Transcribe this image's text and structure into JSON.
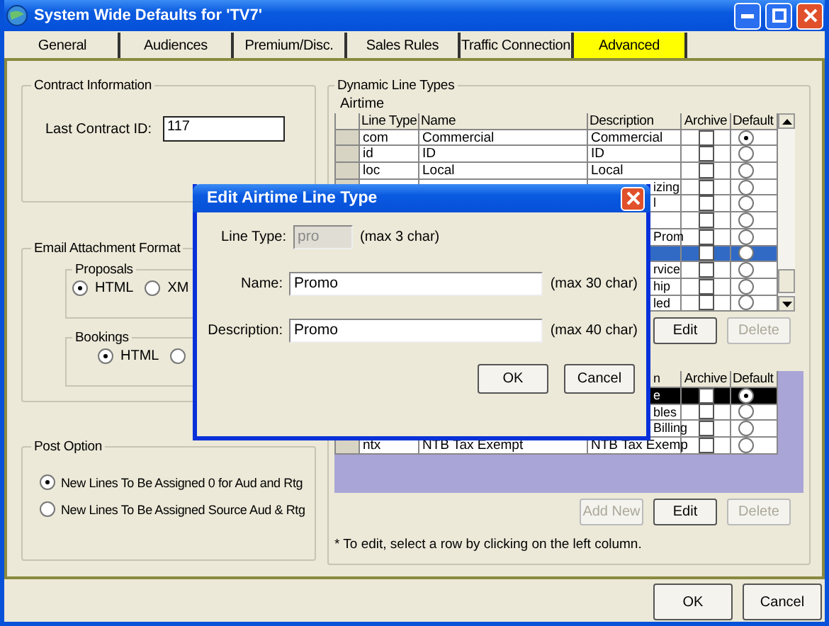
{
  "window": {
    "title": "System Wide Defaults for 'TV7'"
  },
  "tabs": [
    {
      "label": "General",
      "selected": false
    },
    {
      "label": "Audiences",
      "selected": false
    },
    {
      "label": "Premium/Disc.",
      "selected": false
    },
    {
      "label": "Sales Rules",
      "selected": false
    },
    {
      "label": "Traffic Connection",
      "selected": false
    },
    {
      "label": "Advanced",
      "selected": true
    }
  ],
  "contract_information": {
    "title": "Contract Information",
    "label": "Last Contract ID:",
    "value": "117"
  },
  "email_attachment_format": {
    "title": "Email Attachment Format",
    "groups": [
      {
        "title": "Proposals",
        "options": [
          {
            "label": "HTML",
            "selected": true
          },
          {
            "label": "XM",
            "selected": false
          }
        ]
      },
      {
        "title": "Bookings",
        "options": [
          {
            "label": "HTML",
            "selected": true
          },
          {
            "selected": false
          }
        ]
      }
    ]
  },
  "post_option": {
    "title": "Post Option",
    "options": [
      {
        "label": "New Lines To Be Assigned 0 for Aud and Rtg",
        "selected": true
      },
      {
        "label": "New Lines To Be Assigned Source Aud & Rtg",
        "selected": false
      }
    ]
  },
  "dynamic_line_types": {
    "title": "Dynamic Line Types",
    "airtime_label": "Airtime",
    "tables": [
      {
        "header": {
          "line_type": "Line Type",
          "name": "Name",
          "description": "Description",
          "archive": "Archive",
          "default": "Default"
        },
        "rows": [
          {
            "line_type": "com",
            "name": "Commercial",
            "description": "Commercial",
            "archive": false,
            "default": true,
            "selected": false
          },
          {
            "line_type": "id",
            "name": "ID",
            "description": "ID",
            "archive": false,
            "default": false,
            "selected": false
          },
          {
            "line_type": "loc",
            "name": "Local",
            "description": "Local",
            "archive": false,
            "default": false,
            "selected": false
          },
          {
            "description": "izing",
            "archive": false,
            "default": false,
            "selected": false
          },
          {
            "description": "l",
            "archive": false,
            "default": false,
            "selected": false
          },
          {
            "archive": false,
            "default": false,
            "selected": false
          },
          {
            "description": "Prom",
            "archive": false,
            "default": false,
            "selected": false
          },
          {
            "archive": false,
            "default": false,
            "selected": true
          },
          {
            "description": "rvice",
            "archive": false,
            "default": false,
            "selected": false
          },
          {
            "description": "hip",
            "archive": false,
            "default": false,
            "selected": false
          },
          {
            "description": "led",
            "archive": false,
            "default": false,
            "selected": false
          }
        ],
        "buttons": [
          {
            "label": "Edit",
            "disabled": false
          },
          {
            "label": "Delete",
            "disabled": true
          }
        ]
      },
      {
        "header": {
          "description": "n",
          "archive": "Archive",
          "default": "Default"
        },
        "rows": [
          {
            "description": "e",
            "archive": false,
            "default": true,
            "selected": true
          },
          {
            "description": "bles",
            "archive": false,
            "default": false,
            "selected": false
          },
          {
            "description": "Billing",
            "archive": false,
            "default": false,
            "selected": false
          },
          {
            "line_type": "ntx",
            "name": "NTB Tax Exempt",
            "description": "NTB Tax Exemp",
            "archive": false,
            "default": false,
            "selected": false
          }
        ],
        "buttons": [
          {
            "label": "Add New",
            "disabled": true
          },
          {
            "label": "Edit",
            "disabled": false
          },
          {
            "label": "Delete",
            "disabled": true
          }
        ]
      }
    ],
    "note": "* To edit, select a row by clicking on the left column."
  },
  "footer_buttons": [
    {
      "label": "OK"
    },
    {
      "label": "Cancel"
    }
  ],
  "dialog": {
    "title": "Edit Airtime Line Type",
    "fields": [
      {
        "label": "Line Type:",
        "value": "pro",
        "disabled": true,
        "hint": "(max 3 char)"
      },
      {
        "label": "Name:",
        "value": "Promo",
        "disabled": false,
        "hint": "(max 30 char)"
      },
      {
        "label": "Description:",
        "value": "Promo",
        "disabled": false,
        "hint": "(max 40 char)"
      }
    ],
    "buttons": [
      {
        "label": "OK"
      },
      {
        "label": "Cancel"
      }
    ]
  }
}
